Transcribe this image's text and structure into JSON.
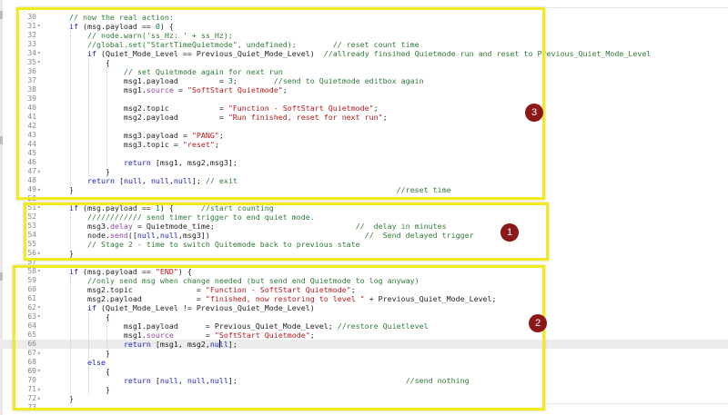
{
  "editor": {
    "lines": [
      {
        "num": "30",
        "fold": "",
        "active": false,
        "tokens": [
          [
            "    // now the real action:",
            "c"
          ]
        ]
      },
      {
        "num": "31",
        "fold": "▾",
        "active": false,
        "tokens": [
          [
            "    ",
            ""
          ],
          [
            "if",
            "k"
          ],
          [
            " (msg.payload == ",
            ""
          ],
          [
            "0",
            "n"
          ],
          [
            ") {",
            ""
          ]
        ]
      },
      {
        "num": "32",
        "fold": "",
        "active": false,
        "tokens": [
          [
            "        // node.warn('ss_Hz: ' + ss_Hz);",
            "c"
          ]
        ]
      },
      {
        "num": "33",
        "fold": "",
        "active": false,
        "tokens": [
          [
            "        //global.set(\"StartTimeQuietmode\", undefined);        // reset count time",
            "c"
          ]
        ]
      },
      {
        "num": "34",
        "fold": "▾",
        "active": false,
        "tokens": [
          [
            "        ",
            ""
          ],
          [
            "if",
            "k"
          ],
          [
            " (Quiet_Mode_Level == Previous_Quiet_Mode_Level)  ",
            ""
          ],
          [
            "//allready finsihed Quietmode run and reset to Previous_Quiet_Mode_Level",
            "c"
          ]
        ]
      },
      {
        "num": "35",
        "fold": "▾",
        "active": false,
        "tokens": [
          [
            "            {",
            ""
          ]
        ]
      },
      {
        "num": "36",
        "fold": "",
        "active": false,
        "tokens": [
          [
            "                // set Quietmode again for next run",
            "c"
          ]
        ]
      },
      {
        "num": "37",
        "fold": "",
        "active": false,
        "tokens": [
          [
            "                msg1.payload         = ",
            ""
          ],
          [
            "3",
            "n"
          ],
          [
            ";        ",
            ""
          ],
          [
            "//send to Quietmode editbox again",
            "c"
          ]
        ]
      },
      {
        "num": "38",
        "fold": "",
        "active": false,
        "tokens": [
          [
            "                msg1.",
            ""
          ],
          [
            "source",
            "p"
          ],
          [
            " = ",
            ""
          ],
          [
            "\"SoftStart Quietmode\"",
            "s"
          ],
          [
            ";",
            ""
          ]
        ]
      },
      {
        "num": "39",
        "fold": "",
        "active": false,
        "tokens": [
          [
            "",
            ""
          ]
        ]
      },
      {
        "num": "40",
        "fold": "",
        "active": false,
        "tokens": [
          [
            "                msg2.topic           = ",
            ""
          ],
          [
            "\"Function - SoftStart Quietmode\"",
            "s"
          ],
          [
            ";",
            ""
          ]
        ]
      },
      {
        "num": "41",
        "fold": "",
        "active": false,
        "tokens": [
          [
            "                msg2.payload         = ",
            ""
          ],
          [
            "\"Run finished, reset for next run\"",
            "s"
          ],
          [
            ";",
            ""
          ]
        ]
      },
      {
        "num": "42",
        "fold": "",
        "active": false,
        "tokens": [
          [
            "",
            ""
          ]
        ]
      },
      {
        "num": "43",
        "fold": "",
        "active": false,
        "tokens": [
          [
            "                msg3.payload = ",
            ""
          ],
          [
            "\"PANG\"",
            "s"
          ],
          [
            ";",
            ""
          ]
        ]
      },
      {
        "num": "44",
        "fold": "",
        "active": false,
        "tokens": [
          [
            "                msg3.topic = ",
            ""
          ],
          [
            "\"reset\"",
            "s"
          ],
          [
            ";",
            ""
          ]
        ]
      },
      {
        "num": "45",
        "fold": "",
        "active": false,
        "tokens": [
          [
            "",
            ""
          ]
        ]
      },
      {
        "num": "46",
        "fold": "",
        "active": false,
        "tokens": [
          [
            "                ",
            ""
          ],
          [
            "return",
            "k"
          ],
          [
            " [msg1, msg2,msg3];",
            ""
          ]
        ]
      },
      {
        "num": "47",
        "fold": "▴",
        "active": false,
        "tokens": [
          [
            "            }",
            ""
          ]
        ]
      },
      {
        "num": "48",
        "fold": "",
        "active": false,
        "tokens": [
          [
            "        ",
            ""
          ],
          [
            "return",
            "k"
          ],
          [
            " [",
            ""
          ],
          [
            "null",
            "k"
          ],
          [
            ", ",
            ""
          ],
          [
            "null",
            "k"
          ],
          [
            ",",
            ""
          ],
          [
            "null",
            "k"
          ],
          [
            "]; ",
            ""
          ],
          [
            "// exit",
            "c"
          ]
        ]
      },
      {
        "num": "49",
        "fold": "▴",
        "active": false,
        "tokens": [
          [
            "    }                                                                       ",
            ""
          ],
          [
            "//reset time",
            "c"
          ]
        ]
      },
      {
        "num": "50",
        "fold": "",
        "active": false,
        "tokens": [
          [
            "",
            ""
          ]
        ]
      },
      {
        "num": "51",
        "fold": "▾",
        "active": false,
        "tokens": [
          [
            "    ",
            ""
          ],
          [
            "if",
            "k"
          ],
          [
            " (msg.payload == ",
            ""
          ],
          [
            "1",
            "n"
          ],
          [
            ") {      ",
            ""
          ],
          [
            "//start counting",
            "c"
          ]
        ]
      },
      {
        "num": "52",
        "fold": "",
        "active": false,
        "tokens": [
          [
            "        //////////// send timer trigger to end quiet mode.",
            "c"
          ]
        ]
      },
      {
        "num": "53",
        "fold": "",
        "active": false,
        "tokens": [
          [
            "        msg3.",
            ""
          ],
          [
            "delay",
            "p"
          ],
          [
            " = Quietmode_time;                               ",
            ""
          ],
          [
            "//  delay in minutes",
            "c"
          ]
        ]
      },
      {
        "num": "54",
        "fold": "",
        "active": false,
        "tokens": [
          [
            "        node.",
            ""
          ],
          [
            "send",
            "p"
          ],
          [
            "([",
            ""
          ],
          [
            "null",
            "k"
          ],
          [
            ",",
            ""
          ],
          [
            "null",
            "k"
          ],
          [
            ",msg3])                                  ",
            ""
          ],
          [
            "//  Send delayed trigger",
            "c"
          ]
        ]
      },
      {
        "num": "55",
        "fold": "",
        "active": false,
        "tokens": [
          [
            "        // Stage 2 - time to switch Quitemode back to previous state",
            "c"
          ]
        ]
      },
      {
        "num": "56",
        "fold": "▴",
        "active": false,
        "tokens": [
          [
            "    }",
            ""
          ]
        ]
      },
      {
        "num": "57",
        "fold": "",
        "active": false,
        "tokens": [
          [
            "",
            ""
          ]
        ]
      },
      {
        "num": "58",
        "fold": "▾",
        "active": false,
        "tokens": [
          [
            "    ",
            ""
          ],
          [
            "if",
            "k"
          ],
          [
            " (msg.payload == ",
            ""
          ],
          [
            "\"END\"",
            "s"
          ],
          [
            ") {",
            ""
          ]
        ]
      },
      {
        "num": "59",
        "fold": "",
        "active": false,
        "tokens": [
          [
            "        //only send msg when change needed (but send end Quietmode to log anyway)",
            "c"
          ]
        ]
      },
      {
        "num": "60",
        "fold": "",
        "active": false,
        "tokens": [
          [
            "        msg2.topic              = ",
            ""
          ],
          [
            "\"Function - SoftStart Quietmode\"",
            "s"
          ],
          [
            ";",
            ""
          ]
        ]
      },
      {
        "num": "61",
        "fold": "",
        "active": false,
        "tokens": [
          [
            "        msg2.payload            = ",
            ""
          ],
          [
            "\"finished, now restoring to level \"",
            "s"
          ],
          [
            " + Previous_Quiet_Mode_Level;",
            ""
          ]
        ]
      },
      {
        "num": "62",
        "fold": "▾",
        "active": false,
        "tokens": [
          [
            "        ",
            ""
          ],
          [
            "if",
            "k"
          ],
          [
            " (Quiet_Mode_Level != Previous_Quiet_Mode_Level)",
            ""
          ]
        ]
      },
      {
        "num": "63",
        "fold": "▾",
        "active": false,
        "tokens": [
          [
            "            {",
            ""
          ]
        ]
      },
      {
        "num": "64",
        "fold": "",
        "active": false,
        "tokens": [
          [
            "                msg1.payload      = Previous_Quiet_Mode_Level; ",
            ""
          ],
          [
            "//restore Quietlevel",
            "c"
          ]
        ]
      },
      {
        "num": "65",
        "fold": "",
        "active": false,
        "tokens": [
          [
            "                msg1.",
            ""
          ],
          [
            "source",
            "p"
          ],
          [
            "       = ",
            ""
          ],
          [
            "\"SoftStart Quietmode\"",
            "s"
          ],
          [
            ";",
            ""
          ]
        ]
      },
      {
        "num": "66",
        "fold": "",
        "active": true,
        "tokens": [
          [
            "                ",
            ""
          ],
          [
            "return",
            "k"
          ],
          [
            " [msg1, msg2,",
            ""
          ],
          [
            "null",
            "k"
          ],
          [
            "];",
            ""
          ]
        ]
      },
      {
        "num": "67",
        "fold": "▴",
        "active": false,
        "tokens": [
          [
            "            }",
            ""
          ]
        ]
      },
      {
        "num": "68",
        "fold": "",
        "active": false,
        "tokens": [
          [
            "        ",
            ""
          ],
          [
            "else",
            "k"
          ]
        ]
      },
      {
        "num": "69",
        "fold": "▾",
        "active": false,
        "tokens": [
          [
            "            {",
            ""
          ]
        ]
      },
      {
        "num": "70",
        "fold": "",
        "active": false,
        "tokens": [
          [
            "                ",
            ""
          ],
          [
            "return",
            "k"
          ],
          [
            " [",
            ""
          ],
          [
            "null",
            "k"
          ],
          [
            ", ",
            ""
          ],
          [
            "null",
            "k"
          ],
          [
            ",",
            ""
          ],
          [
            "null",
            "k"
          ],
          [
            "];                                     ",
            ""
          ],
          [
            "//send nothing",
            "c"
          ]
        ]
      },
      {
        "num": "71",
        "fold": "▴",
        "active": false,
        "tokens": [
          [
            "            }",
            ""
          ]
        ]
      },
      {
        "num": "72",
        "fold": "▴",
        "active": false,
        "tokens": [
          [
            "    }",
            ""
          ]
        ]
      },
      {
        "num": "73",
        "fold": "",
        "active": false,
        "tokens": [
          [
            "",
            ""
          ]
        ]
      }
    ]
  },
  "annotations": {
    "badge_1": "1",
    "badge_2": "2",
    "badge_3": "3",
    "highlight_color": "#f2ea20",
    "badge_color": "#8b1717"
  },
  "colors": {
    "comment": "#2f7b35",
    "keyword": "#1a25b8",
    "string": "#b8191c",
    "number": "#0a7d5e",
    "property": "#8f46a6"
  }
}
